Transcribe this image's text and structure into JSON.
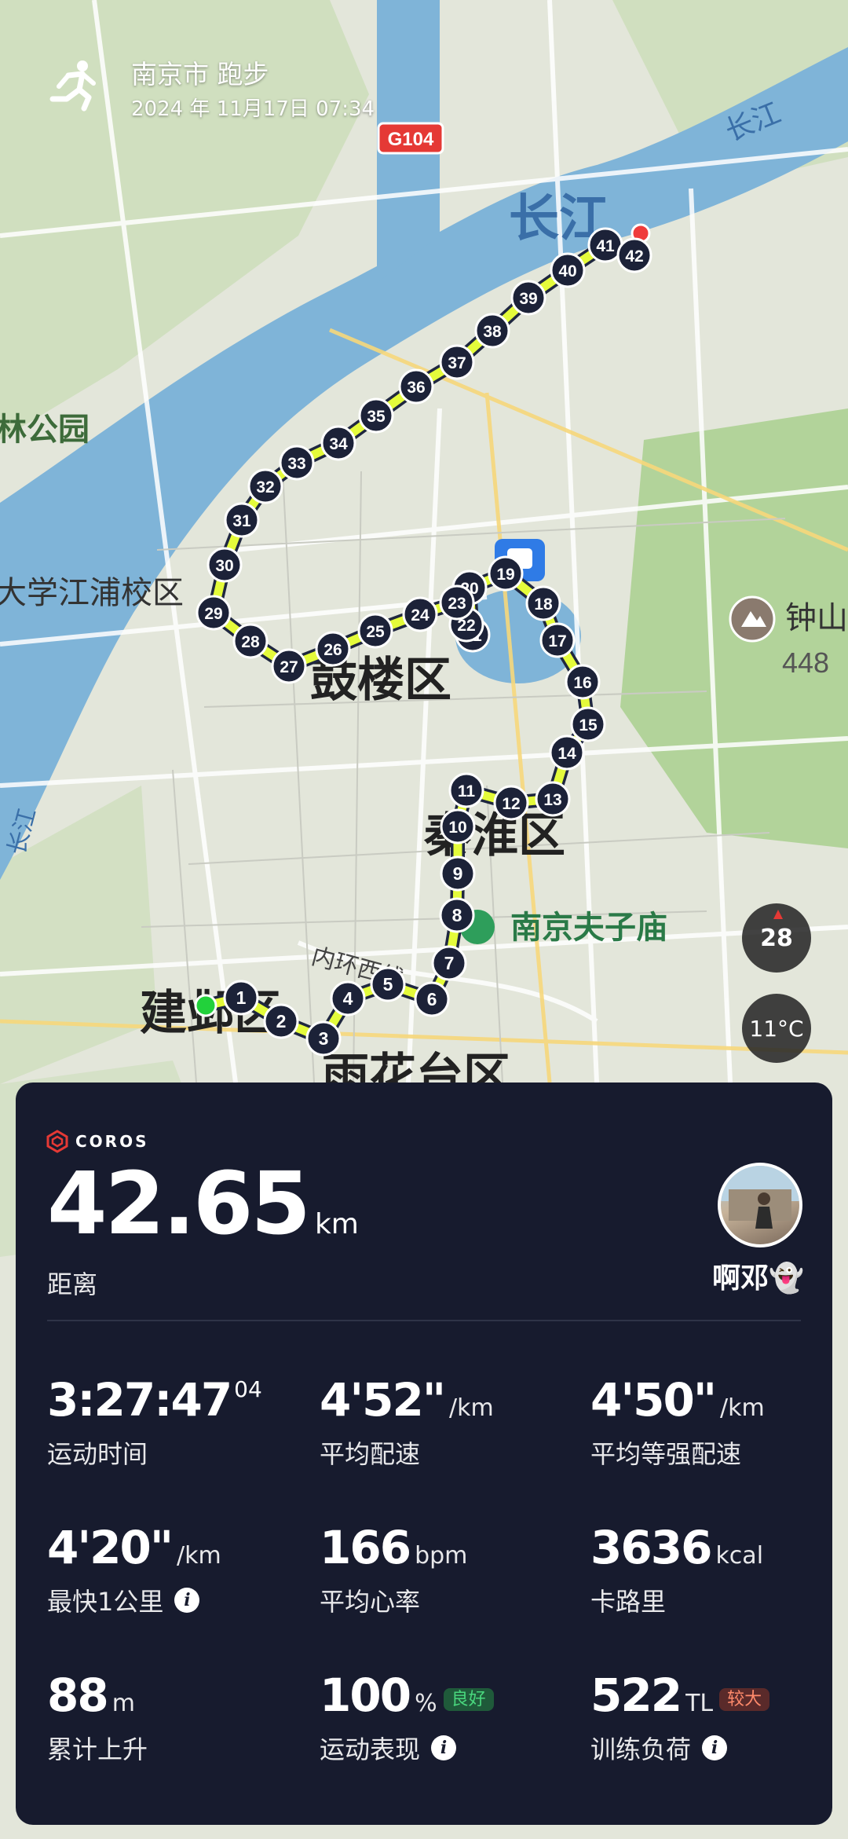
{
  "header": {
    "title": "南京市 跑步",
    "date": "2024 年 11月17日 07:34"
  },
  "map": {
    "labels": {
      "road_sign": "G104",
      "changjiang_big": "长江",
      "changjiang_small_ne": "长江",
      "changjiang_small_w": "长江",
      "forest_park": "林公园",
      "campus": "大学江浦校区",
      "gulou": "鼓楼区",
      "qinhuai": "秦淮区",
      "fuzimiao": "南京夫子庙",
      "inner_ring": "内环西线",
      "jianye": "建邺区",
      "yuhuatai": "雨花台区",
      "zhongshan": "钟山",
      "zhongshan_elev": "448"
    },
    "km_markers": [
      "1",
      "2",
      "3",
      "4",
      "5",
      "6",
      "7",
      "8",
      "9",
      "10",
      "11",
      "12",
      "13",
      "14",
      "15",
      "16",
      "17",
      "18",
      "19",
      "20",
      "21",
      "22",
      "23",
      "24",
      "25",
      "26",
      "27",
      "28",
      "29",
      "30",
      "31",
      "32",
      "33",
      "34",
      "35",
      "36",
      "37",
      "38",
      "39",
      "40",
      "41",
      "42"
    ],
    "colors": {
      "water": "#7fb4d8",
      "route": "#e4fb3b",
      "start": "#22d13b",
      "end": "#ef3b3b"
    },
    "compass_value": "28",
    "temperature": "11°C"
  },
  "card": {
    "brand": "COROS",
    "distance": {
      "value": "42.65",
      "unit": "km",
      "label": "距离"
    },
    "user_name": "啊邓👻",
    "stats": [
      {
        "value": "3:27:47",
        "sup": "04",
        "unit": "",
        "label": "运动时间"
      },
      {
        "value": "4'52\"",
        "unit": "/km",
        "label": "平均配速"
      },
      {
        "value": "4'50\"",
        "unit": "/km",
        "label": "平均等强配速"
      },
      {
        "value": "4'20\"",
        "unit": "/km",
        "label": "最快1公里",
        "info": true
      },
      {
        "value": "166",
        "unit": "bpm",
        "label": "平均心率"
      },
      {
        "value": "3636",
        "unit": "kcal",
        "label": "卡路里"
      },
      {
        "value": "88",
        "unit": "m",
        "label": "累计上升"
      },
      {
        "value": "100",
        "unit": "%",
        "badge": "良好",
        "label": "运动表现",
        "info": true
      },
      {
        "value": "522",
        "unit": "TL",
        "badge": "较大",
        "label": "训练负荷",
        "info": true
      }
    ]
  }
}
